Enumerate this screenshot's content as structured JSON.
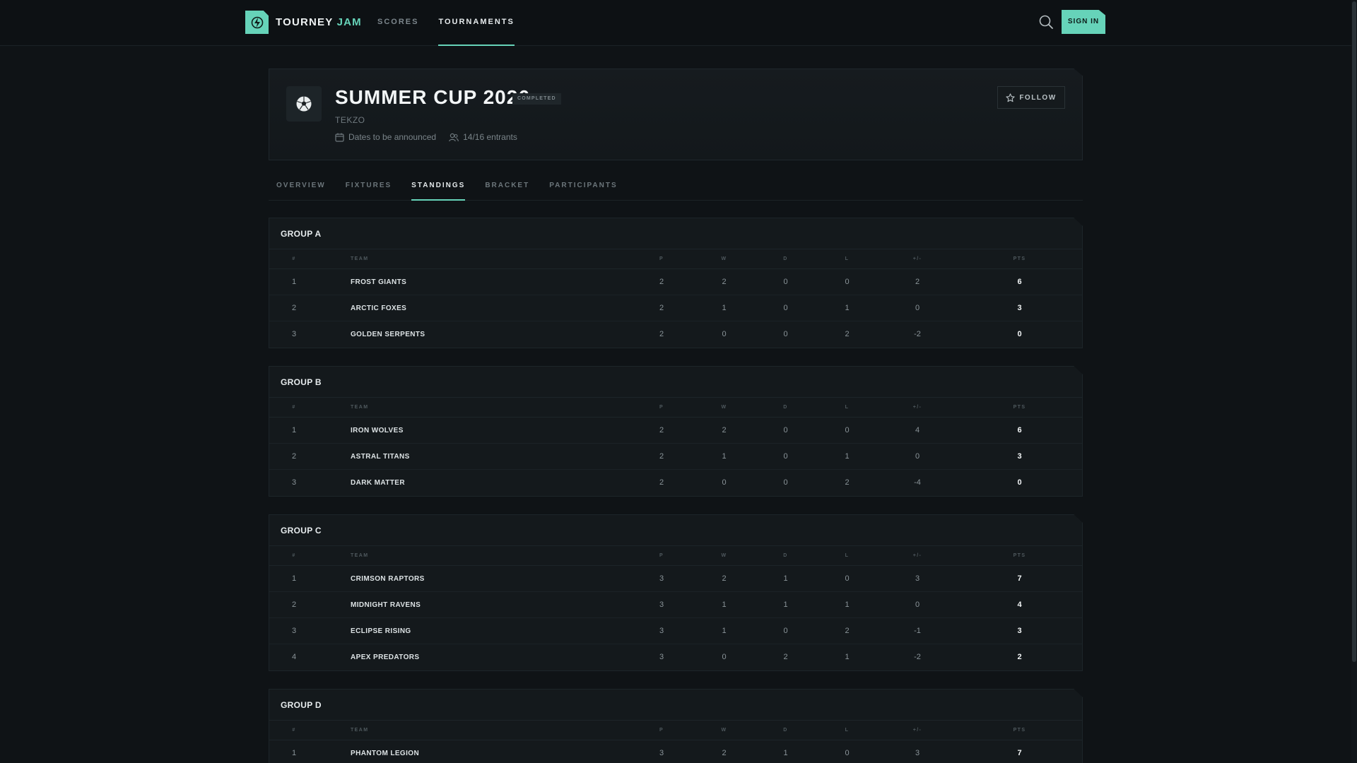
{
  "app": {
    "logo_text": "TOURNEY",
    "logo_accent": "JAM",
    "nav": [
      {
        "label": "SCORES",
        "active": false
      },
      {
        "label": "TOURNAMENTS",
        "active": true
      }
    ],
    "sign_in_label": "SIGN IN",
    "accent_color": "#66d3b9"
  },
  "tournament": {
    "title": "SUMMER CUP 2026",
    "status": "COMPLETED",
    "organizer": "TEKZO",
    "dates": "Dates to be announced",
    "entrants": "14/16 entrants",
    "follow_label": "FOLLOW",
    "icon": "soccer-ball-icon"
  },
  "tabs": [
    {
      "label": "OVERVIEW",
      "active": false
    },
    {
      "label": "FIXTURES",
      "active": false
    },
    {
      "label": "STANDINGS",
      "active": true
    },
    {
      "label": "BRACKET",
      "active": false
    },
    {
      "label": "PARTICIPANTS",
      "active": false
    }
  ],
  "table_headers": [
    "#",
    "TEAM",
    "P",
    "W",
    "D",
    "L",
    "+/-",
    "PTS"
  ],
  "groups": [
    {
      "title": "GROUP A",
      "rows": [
        {
          "rank": "1",
          "team": "FROST GIANTS",
          "p": "2",
          "w": "2",
          "d": "0",
          "l": "0",
          "gd": "2",
          "pts": "6"
        },
        {
          "rank": "2",
          "team": "ARCTIC FOXES",
          "p": "2",
          "w": "1",
          "d": "0",
          "l": "1",
          "gd": "0",
          "pts": "3"
        },
        {
          "rank": "3",
          "team": "GOLDEN SERPENTS",
          "p": "2",
          "w": "0",
          "d": "0",
          "l": "2",
          "gd": "-2",
          "pts": "0"
        }
      ]
    },
    {
      "title": "GROUP B",
      "rows": [
        {
          "rank": "1",
          "team": "IRON WOLVES",
          "p": "2",
          "w": "2",
          "d": "0",
          "l": "0",
          "gd": "4",
          "pts": "6"
        },
        {
          "rank": "2",
          "team": "ASTRAL TITANS",
          "p": "2",
          "w": "1",
          "d": "0",
          "l": "1",
          "gd": "0",
          "pts": "3"
        },
        {
          "rank": "3",
          "team": "DARK MATTER",
          "p": "2",
          "w": "0",
          "d": "0",
          "l": "2",
          "gd": "-4",
          "pts": "0"
        }
      ]
    },
    {
      "title": "GROUP C",
      "rows": [
        {
          "rank": "1",
          "team": "CRIMSON RAPTORS",
          "p": "3",
          "w": "2",
          "d": "1",
          "l": "0",
          "gd": "3",
          "pts": "7"
        },
        {
          "rank": "2",
          "team": "MIDNIGHT RAVENS",
          "p": "3",
          "w": "1",
          "d": "1",
          "l": "1",
          "gd": "0",
          "pts": "4"
        },
        {
          "rank": "3",
          "team": "ECLIPSE RISING",
          "p": "3",
          "w": "1",
          "d": "0",
          "l": "2",
          "gd": "-1",
          "pts": "3"
        },
        {
          "rank": "4",
          "team": "APEX PREDATORS",
          "p": "3",
          "w": "0",
          "d": "2",
          "l": "1",
          "gd": "-2",
          "pts": "2"
        }
      ]
    },
    {
      "title": "GROUP D",
      "rows": [
        {
          "rank": "1",
          "team": "PHANTOM LEGION",
          "p": "3",
          "w": "2",
          "d": "1",
          "l": "0",
          "gd": "3",
          "pts": "7"
        }
      ]
    }
  ]
}
